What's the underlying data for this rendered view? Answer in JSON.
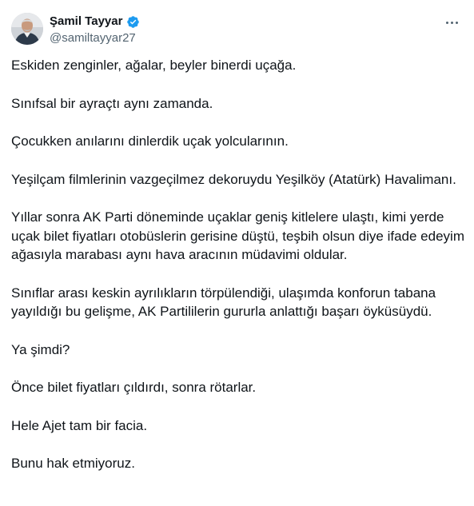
{
  "author": {
    "display_name": "Şamil Tayyar",
    "handle": "@samiltayyar27",
    "verified": true
  },
  "icons": {
    "verified": "verified-badge-icon",
    "more": "more-options-icon",
    "avatar": "profile-photo"
  },
  "colors": {
    "verified_blue": "#1d9bf0",
    "text_primary": "#0f1419",
    "text_secondary": "#536471"
  },
  "tweet": {
    "paragraphs": [
      "Eskiden zenginler, ağalar, beyler binerdi uçağa.",
      "Sınıfsal bir ayraçtı aynı zamanda.",
      "Çocukken anılarını dinlerdik uçak yolcularının.",
      "Yeşilçam filmlerinin vazgeçilmez dekoruydu Yeşilköy (Atatürk) Havalimanı.",
      "Yıllar sonra AK Parti döneminde uçaklar geniş kitlelere ulaştı, kimi yerde uçak bilet fiyatları otobüslerin gerisine düştü, teşbih olsun diye ifade edeyim ağasıyla marabası aynı hava aracının müdavimi oldular.",
      "Sınıflar arası keskin ayrılıkların törpülendiği, ulaşımda konforun tabana yayıldığı bu gelişme, AK Partililerin gururla anlattığı başarı öyküsüydü.",
      "Ya şimdi?",
      "Önce bilet fiyatları çıldırdı, sonra rötarlar.",
      "Hele Ajet tam bir facia.",
      "Bunu hak etmiyoruz."
    ]
  }
}
